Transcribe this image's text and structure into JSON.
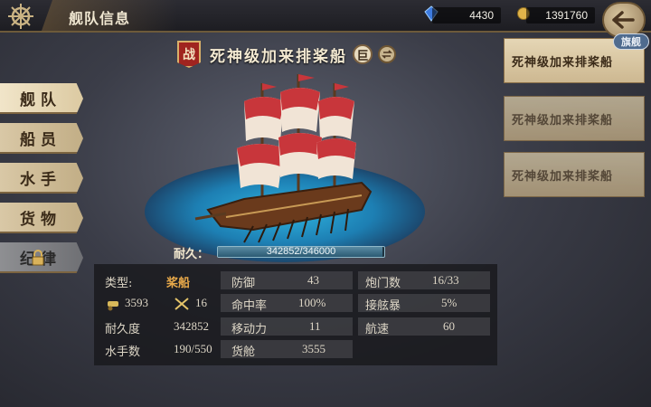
{
  "header": {
    "title": "舰队信息",
    "gems": "4430",
    "gold": "1391760"
  },
  "menu": [
    {
      "label": "舰队",
      "active": true
    },
    {
      "label": "船员"
    },
    {
      "label": "水手"
    },
    {
      "label": "货物"
    },
    {
      "label": "纪律",
      "locked": true
    }
  ],
  "ship": {
    "badge": "战",
    "name": "死神级加来排桨船",
    "size": "巨",
    "durability_label": "耐久：",
    "durability_text": "342852/346000",
    "durability_fraction": 0.991
  },
  "stats": {
    "type_label": "类型:",
    "type_value": "桨船",
    "cannon_count": "3593",
    "crew_count": "16",
    "durability_label": "耐久度",
    "durability_value": "342852",
    "sailors_label": "水手数",
    "sailors_value": "190/550",
    "defense_label": "防御",
    "defense_value": "43",
    "hit_label": "命中率",
    "hit_value": "100%",
    "mobility_label": "移动力",
    "mobility_value": "11",
    "cargo_label": "货舱",
    "cargo_value": "3555",
    "gunport_label": "炮门数",
    "gunport_value": "16/33",
    "boarding_label": "接舷暴",
    "boarding_value": "5%",
    "speed_label": "航速",
    "speed_value": "60"
  },
  "fleet": [
    {
      "name": "死神级加来排桨船",
      "tag": "旗舰"
    },
    {
      "name": "死神级加来排桨船"
    },
    {
      "name": "死神级加来排桨船"
    }
  ],
  "colors": {
    "accent": "#e8a94a",
    "sea": "#2fb4e0",
    "sail": "#c8363b"
  }
}
